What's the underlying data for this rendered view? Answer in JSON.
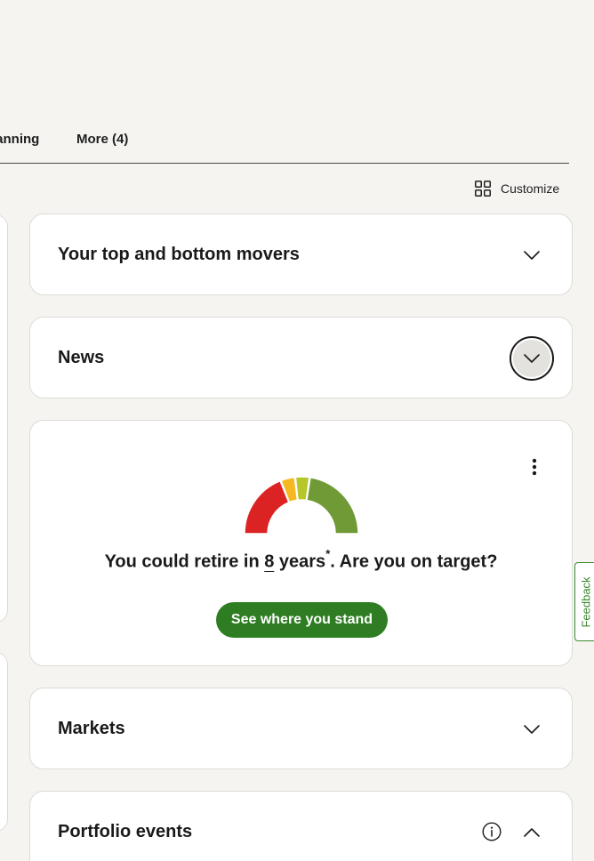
{
  "tabs": {
    "planning_label": "Planning",
    "more_label": "More (4)"
  },
  "toolbar": {
    "customize_label": "Customize",
    "customize_icon": "grid-icon"
  },
  "cards": {
    "movers": {
      "title": "Your top and bottom movers",
      "icon": "chevron-down-icon"
    },
    "news": {
      "title": "News",
      "icon": "chevron-down-icon",
      "focused": true
    },
    "retirement": {
      "text_before": "You could retire in",
      "years_value": "8",
      "years_unit": "years",
      "footnote_mark": "*",
      "text_after": ". Are you on target?",
      "cta_label": "See where you stand",
      "menu_icon": "kebab-menu-icon",
      "gauge_colors": [
        "#dc2323",
        "#f5b820",
        "#b5c72a",
        "#6f9a36"
      ]
    },
    "markets": {
      "title": "Markets",
      "icon": "chevron-down-icon"
    },
    "portfolio_events": {
      "title": "Portfolio events",
      "info_icon": "info-icon",
      "icon": "chevron-up-icon"
    }
  },
  "feedback": {
    "label": "Feedback"
  },
  "colors": {
    "background": "#f5f4f1",
    "card": "#ffffff",
    "accent_green": "#2e7d22",
    "feedback_green": "#3c8a2e"
  }
}
